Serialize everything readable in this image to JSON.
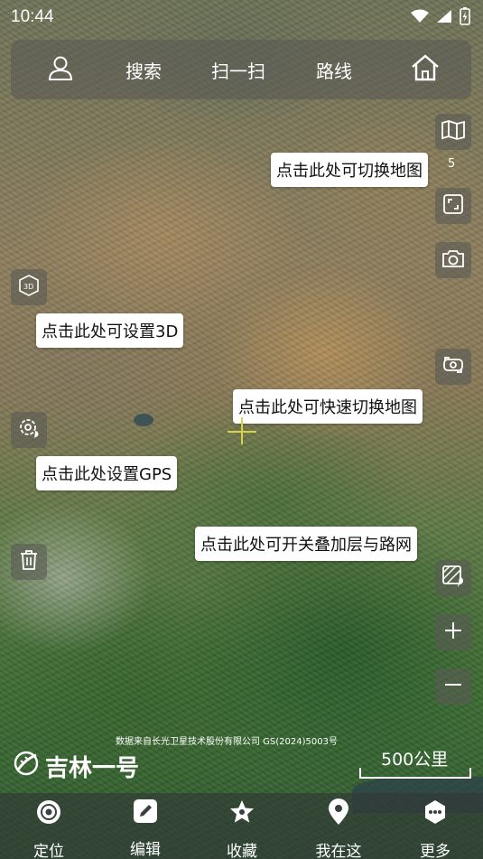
{
  "status_bar": {
    "time": "10:44"
  },
  "top_bar": {
    "search_label": "搜索",
    "scan_label": "扫一扫",
    "route_label": "路线"
  },
  "tooltips": {
    "switch_map": "点击此处可切换地图",
    "set_3d": "点击此处可设置3D",
    "quick_switch_map": "点击此处可快速切换地图",
    "set_gps": "点击此处设置GPS",
    "toggle_layers": "点击此处可开关叠加层与路网"
  },
  "map_badge": "5",
  "attribution": "数据来自长光卫星技术股份有限公司 GS(2024)5003号",
  "logo_text": "吉林一号",
  "scale_label": "500公里",
  "bottom_nav": [
    {
      "label": "定位",
      "icon": "locate-icon"
    },
    {
      "label": "编辑",
      "icon": "edit-icon"
    },
    {
      "label": "收藏",
      "icon": "star-icon"
    },
    {
      "label": "我在这",
      "icon": "pin-icon"
    },
    {
      "label": "更多",
      "icon": "more-icon"
    }
  ],
  "colors": {
    "crosshair": "#d7d24a",
    "panel": "#5a5a55"
  }
}
